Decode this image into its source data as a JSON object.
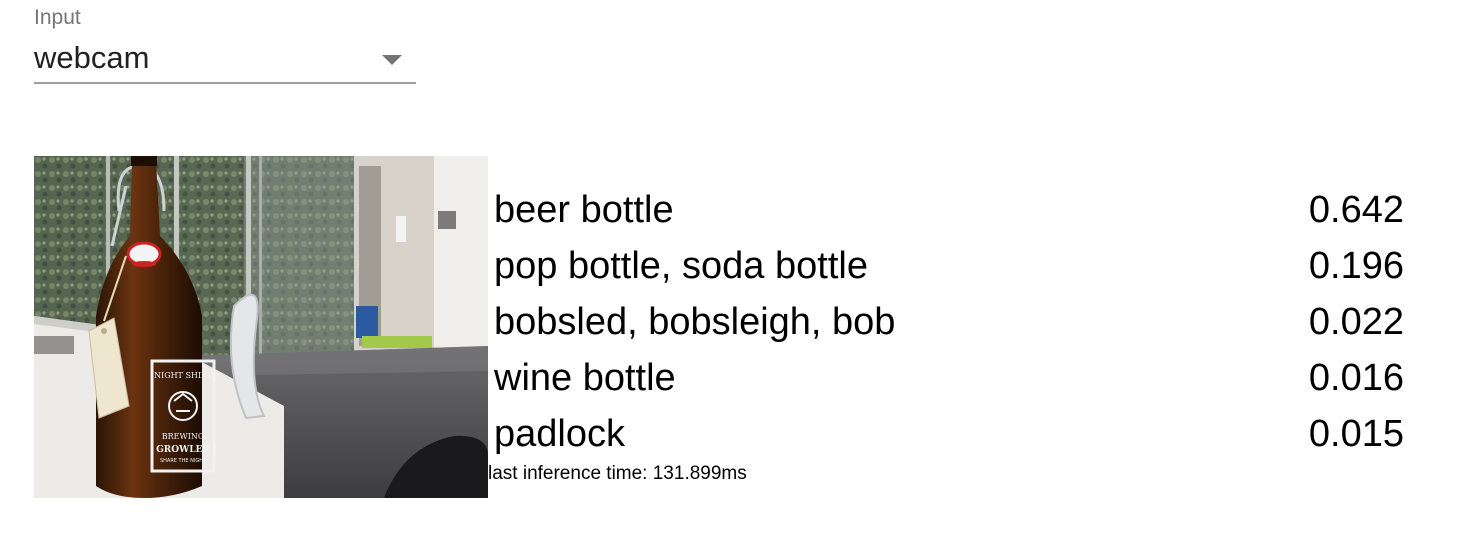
{
  "input": {
    "label": "Input",
    "selected": "webcam"
  },
  "predictions": [
    {
      "label": "beer bottle",
      "score": "0.642"
    },
    {
      "label": "pop bottle, soda bottle",
      "score": "0.196"
    },
    {
      "label": "bobsled, bobsleigh, bob",
      "score": "0.022"
    },
    {
      "label": "wine bottle",
      "score": "0.016"
    },
    {
      "label": "padlock",
      "score": "0.015"
    }
  ],
  "inference": {
    "text": "last inference time: 131.899ms"
  },
  "webcam_frame": {
    "bottle_label_lines": [
      "NIGHT SHIFT",
      "BREWING",
      "GROWLER",
      "SHARE THE NIGHT"
    ]
  }
}
